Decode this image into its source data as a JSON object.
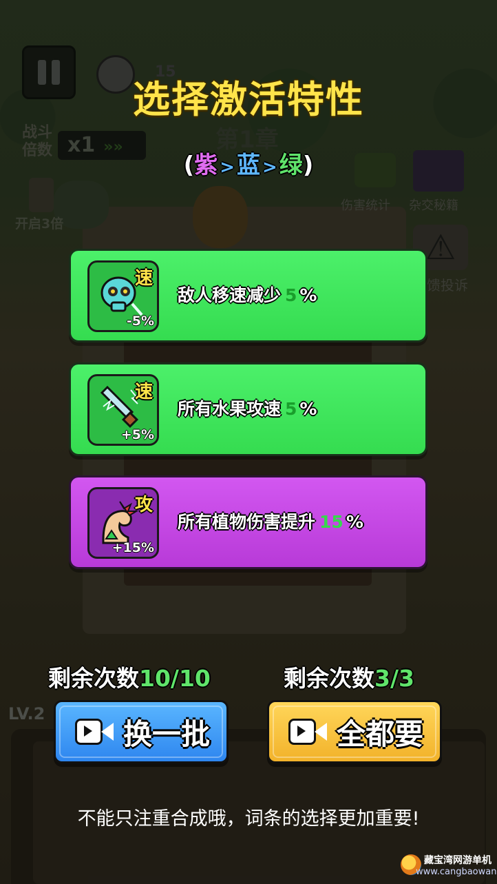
{
  "background_hud": {
    "level_badge": "15",
    "battle_label": "战斗倍数",
    "speed_value": "x1",
    "speed_arrows": "»»",
    "chapter": "第1章",
    "triple_label": "开启3倍",
    "damage_stats_label": "伤害统计",
    "hybrid_book_label": "杂交秘籍",
    "report_label": "馈投诉",
    "warning_glyph": "⚠",
    "lv_tag": "LV.2"
  },
  "dialog": {
    "title": "选择激活特性",
    "rarity": {
      "open": "(",
      "purple": "紫",
      "sep": ">",
      "blue": "蓝",
      "green": "绿",
      "close": ")"
    },
    "cards": [
      {
        "color": "green",
        "icon": "skull-speed-icon",
        "tag": "速",
        "icon_value": "-5%",
        "text": "敌人移速减少",
        "value": "5",
        "unit": "%"
      },
      {
        "color": "green",
        "icon": "lightning-sword-icon",
        "tag": "速",
        "icon_value": "+5%",
        "text": "所有水果攻速",
        "value": "5",
        "unit": "%"
      },
      {
        "color": "purple",
        "icon": "muscle-arm-icon",
        "tag": "攻",
        "icon_value": "+15%",
        "text": "所有植物伤害提升",
        "value": "15",
        "unit": "%"
      }
    ],
    "left_remain": {
      "label": "剩余次数",
      "count": "10/10"
    },
    "right_remain": {
      "label": "剩余次数",
      "count": "3/3"
    },
    "refresh_button": "换一批",
    "take_all_button": "全都要",
    "hint": "不能只注重合成哦，词条的选择更加重要!"
  },
  "watermark": {
    "name": "藏宝湾网游单机",
    "url": "www.cangbaowan.net"
  },
  "colors": {
    "title_yellow": "#ffe44a",
    "card_green": "#3fe35b",
    "card_purple": "#c647e4",
    "button_blue": "#2e86ef",
    "button_yellow": "#f2b22a",
    "count_green": "#60e46a"
  }
}
